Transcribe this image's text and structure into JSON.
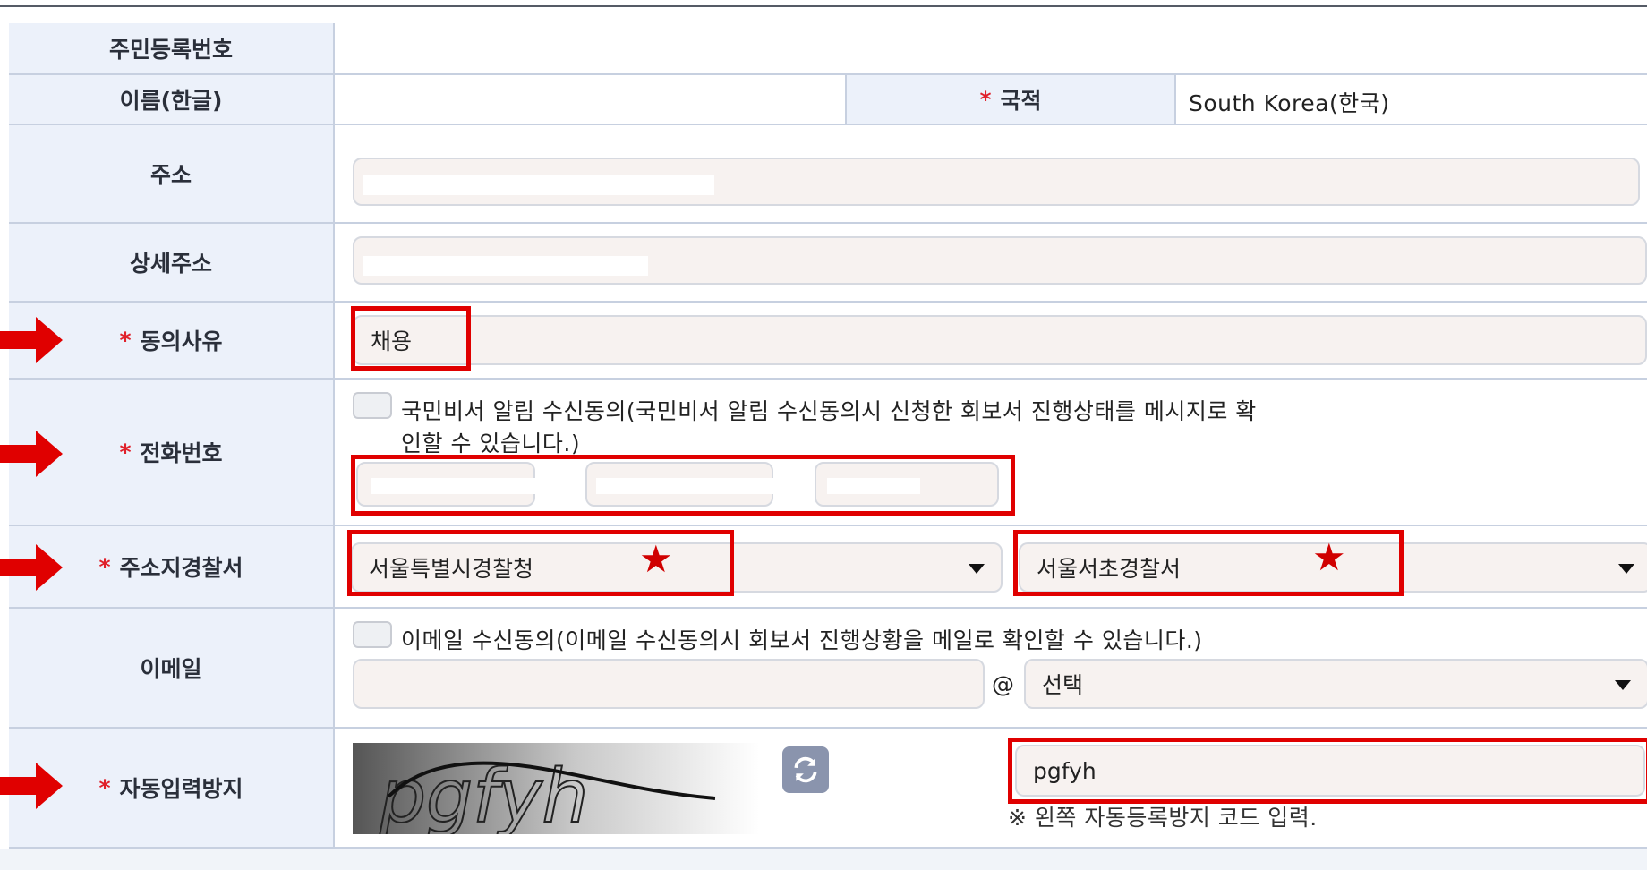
{
  "rows": {
    "rrn": {
      "label": "주민등록번호",
      "value": ""
    },
    "name": {
      "label": "이름(한글)",
      "value": "",
      "nationality_label": "국적",
      "nationality_value": "South Korea(한국)"
    },
    "address": {
      "label": "주소",
      "value": ""
    },
    "detail_address": {
      "label": "상세주소",
      "value": ""
    },
    "consent_reason": {
      "label": "동의사유",
      "value": "채용"
    },
    "phone": {
      "label": "전화번호",
      "sms_consent_text_line1": "국민비서 알림 수신동의(국민비서 알림 수신동의시 신청한 회보서 진행상태를 메시지로 확",
      "sms_consent_text_line2": "인할 수 있습니다.)"
    },
    "police": {
      "label": "주소지경찰서",
      "agency": "서울특별시경찰청",
      "station": "서울서초경찰서"
    },
    "email": {
      "label": "이메일",
      "consent_text": "이메일 수신동의(이메일 수신동의시 회보서 진행상황을 메일로 확인할 수 있습니다.)",
      "at": "@",
      "domain_select": "선택"
    },
    "captcha": {
      "label": "자동입력방지",
      "image_text": "pgfyh",
      "input_value": "pgfyh",
      "hint": "※ 왼쪽 자동등록방지 코드 입력."
    }
  },
  "required_mark": "*",
  "star_glyph": "★",
  "accent_red": "#e00000",
  "icons": {
    "arrow": "red-arrow-icon",
    "refresh": "refresh-icon",
    "dropdown": "caret-down-icon"
  }
}
